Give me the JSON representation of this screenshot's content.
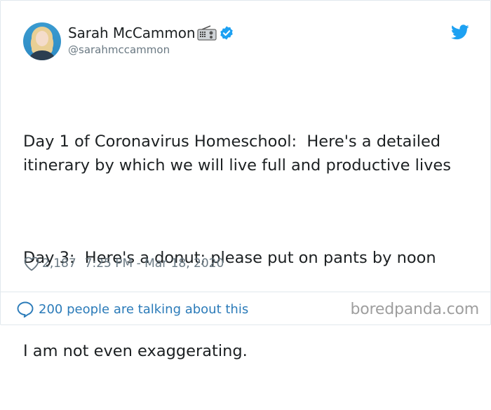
{
  "tweet": {
    "author": {
      "display_name": "Sarah McCammon",
      "handle": "@sarahmccammon",
      "avatar_icon": "avatar-photo",
      "badge_icons": [
        "radio-icon",
        "verified-badge-icon"
      ]
    },
    "platform_icon": "twitter-bird-icon",
    "text_paragraphs": [
      "Day 1 of Coronavirus Homeschool:  Here's a detailed itinerary by which we will live full and productive lives",
      "Day 3:  Here's a donut; please put on pants by noon",
      "I am not even exaggerating."
    ],
    "likes": "2,187",
    "timestamp": "7:25 PM - Mar 18, 2020",
    "conversation_link": "200 people are talking about this"
  },
  "watermark": "boredpanda.com",
  "colors": {
    "text": "#1c2022",
    "muted": "#697882",
    "link": "#2b7bb9",
    "twitter_blue": "#1da1f2",
    "border": "#e1e8ed"
  }
}
